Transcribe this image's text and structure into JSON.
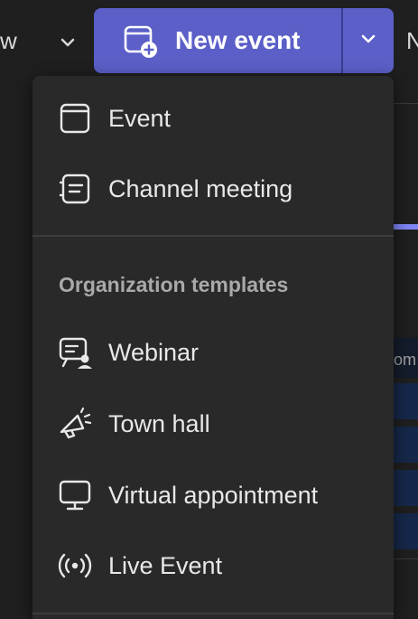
{
  "toolbar": {
    "left_partial_text": "w",
    "right_partial_text": "N",
    "new_event_label": "New event",
    "accent_color": "#5b5fc7"
  },
  "menu": {
    "items_top": [
      {
        "label": "Event",
        "icon": "calendar-icon"
      },
      {
        "label": "Channel meeting",
        "icon": "channel-meeting-icon"
      }
    ],
    "section_header": "Organization templates",
    "items_templates": [
      {
        "label": "Webinar",
        "icon": "webinar-icon"
      },
      {
        "label": "Town hall",
        "icon": "megaphone-icon"
      },
      {
        "label": "Virtual appointment",
        "icon": "monitor-icon"
      },
      {
        "label": "Live Event",
        "icon": "broadcast-icon"
      }
    ]
  },
  "background": {
    "ghost_text": "om"
  }
}
